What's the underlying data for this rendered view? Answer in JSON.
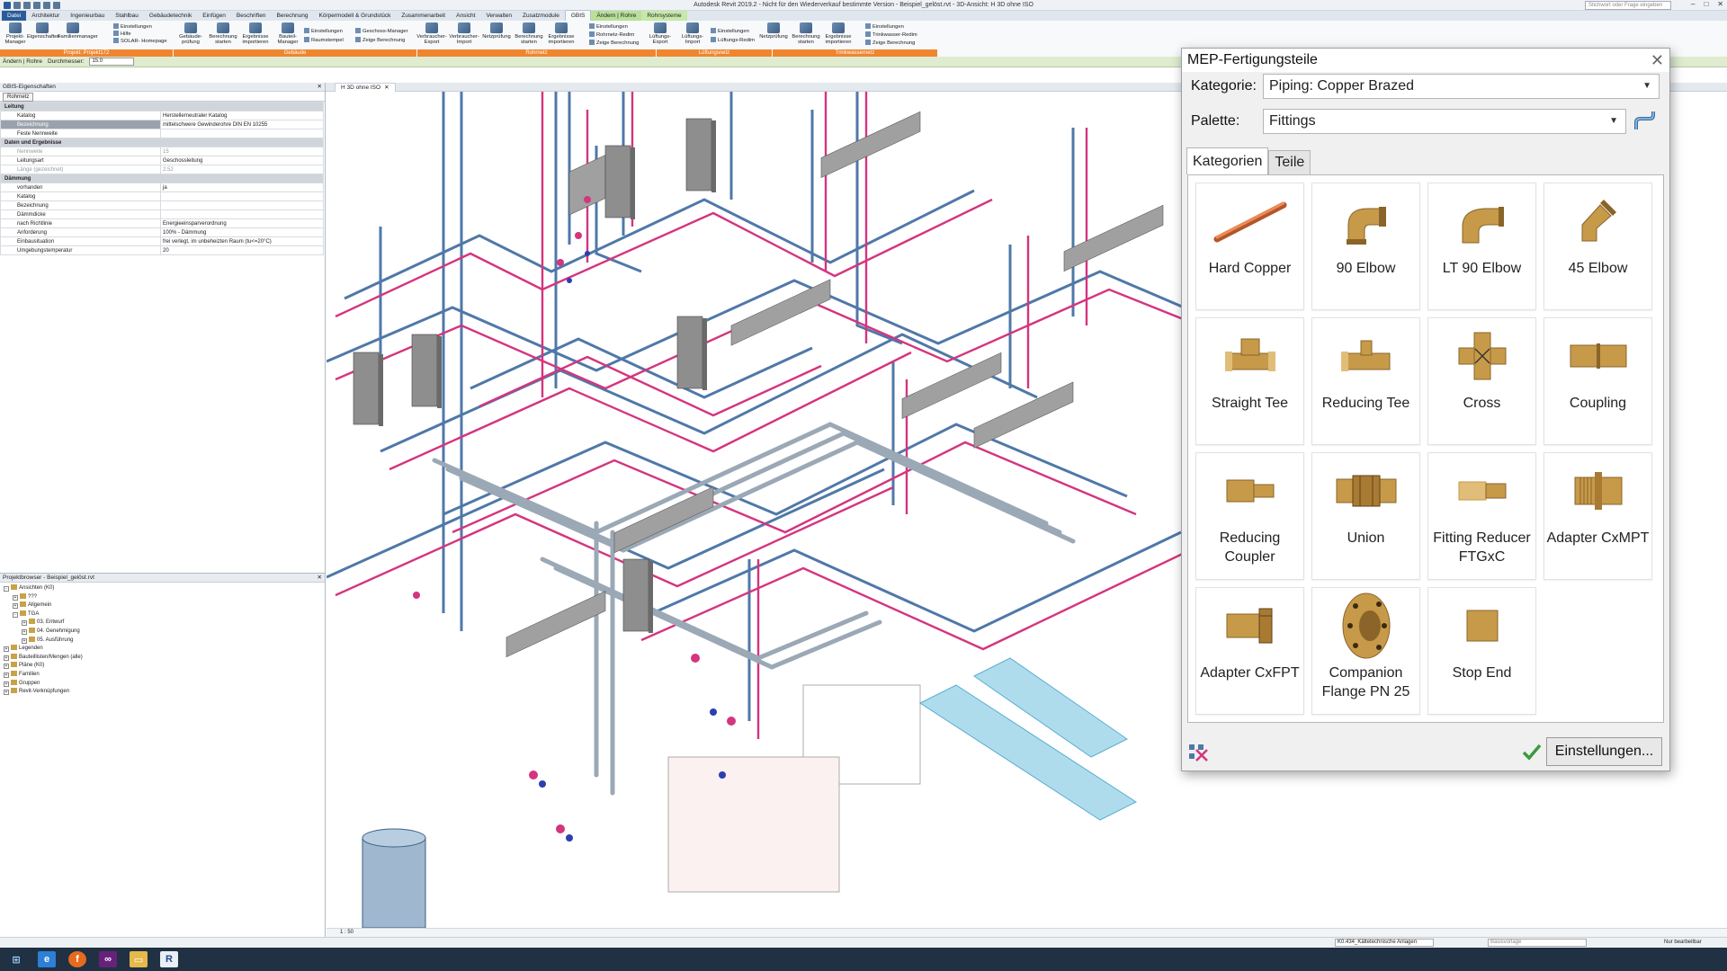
{
  "app": {
    "title": "Autodesk Revit 2019.2 - Nicht für den Wiederverkauf bestimmte Version - Beispiel_gelöst.rvt - 3D-Ansicht: H 3D ohne ISO",
    "search_placeholder": "Stichwort oder Frage eingeben"
  },
  "ribbon_tabs": [
    "Datei",
    "Architektur",
    "Ingenieurbau",
    "Stahlbau",
    "Gebäudetechnik",
    "Einfügen",
    "Beschriften",
    "Berechnung",
    "Körpermodell & Grundstück",
    "Zusammenarbeit",
    "Ansicht",
    "Verwalten",
    "Zusatzmodule",
    "GBIS",
    "Ändern | Rohre",
    "Rohrsysteme"
  ],
  "ribbon": {
    "buttons": [
      {
        "label": "Projekt-Manager"
      },
      {
        "label": "Eigenschaften"
      },
      {
        "label": "Familienmanager"
      },
      {
        "label": "Gebäude-prüfung"
      },
      {
        "label": "Berechnung starten"
      },
      {
        "label": "Ergebnisse importieren"
      },
      {
        "label": "Bauteil-Manager"
      },
      {
        "label": "Verbraucher-Export"
      },
      {
        "label": "Verbraucher-Import"
      },
      {
        "label": "Netzprüfung"
      },
      {
        "label": "Berechnung starten"
      },
      {
        "label": "Ergebnisse importieren"
      },
      {
        "label": "Lüftungs-Export"
      },
      {
        "label": "Lüftungs-Import"
      },
      {
        "label": "Netzprüfung"
      },
      {
        "label": "Berechnung starten"
      },
      {
        "label": "Ergebnisse importieren"
      }
    ],
    "small": [
      "Einstellungen",
      "Hilfe",
      "SOLAR- Homepage",
      "Einstellungen",
      "Raumstempel",
      "Geschoss-Manager",
      "Zeige Berechnung",
      "Einstellungen",
      "Rohrnetz-Redim",
      "Zeige Berechnung",
      "Einstellungen",
      "Lüftungs-Redim",
      "Einstellungen",
      "Trinkwasser-Redim",
      "Zeige Berechnung"
    ],
    "panels": [
      "Projekt: Projekt172",
      "Gebäude",
      "Rohrnetz",
      "Lüftungsnetz",
      "Trinkwassernetz"
    ]
  },
  "options_bar": {
    "mode": "Ändern | Rohre",
    "diameter_label": "Durchmesser:",
    "diameter_value": "15.0"
  },
  "properties": {
    "title": "GBIS-Eigenschaften",
    "type": "Rohrnetz",
    "rows": [
      {
        "k": "Leitung",
        "v": "",
        "group": true
      },
      {
        "k": "Katalog",
        "v": "Herstellerneutraler Katalog"
      },
      {
        "k": "Bezeichnung",
        "v": "mittelschwere Gewinderohre DIN EN 10255",
        "hl": true
      },
      {
        "k": "Feste Nennweite",
        "v": ""
      },
      {
        "k": "Daten und Ergebnisse",
        "v": "",
        "group": true
      },
      {
        "k": "Nennweite",
        "v": "15",
        "dis": true
      },
      {
        "k": "Leitungsart",
        "v": "Geschossleitung"
      },
      {
        "k": "Länge (gezeichnet)",
        "v": "2.52",
        "dis": true
      },
      {
        "k": "Dämmung",
        "v": "",
        "group": true
      },
      {
        "k": "vorhanden",
        "v": "ja"
      },
      {
        "k": "Katalog",
        "v": ""
      },
      {
        "k": "Bezeichnung",
        "v": ""
      },
      {
        "k": "Dämmdicke",
        "v": ""
      },
      {
        "k": "nach Richtlinie",
        "v": "Energieeinsparverordnung"
      },
      {
        "k": "Anforderung",
        "v": "100% - Dämmung"
      },
      {
        "k": "Einbausituation",
        "v": "frei verlegt, im unbeheizten Raum (tu<=20°C)"
      },
      {
        "k": "Umgebungstemperatur",
        "v": "20"
      }
    ]
  },
  "browser": {
    "title": "Projektbrowser - Beispiel_gelöst.rvt",
    "nodes": [
      {
        "label": "Ansichten (K0)",
        "lvl": 0,
        "exp": "-"
      },
      {
        "label": "???",
        "lvl": 1,
        "exp": "+"
      },
      {
        "label": "Allgemein",
        "lvl": 1,
        "exp": "+"
      },
      {
        "label": "TGA",
        "lvl": 1,
        "exp": "-"
      },
      {
        "label": "03. Entwurf",
        "lvl": 2,
        "exp": "+"
      },
      {
        "label": "04. Genehmigung",
        "lvl": 2,
        "exp": "+"
      },
      {
        "label": "05. Ausführung",
        "lvl": 2,
        "exp": "+"
      },
      {
        "label": "Legenden",
        "lvl": 0,
        "exp": "+"
      },
      {
        "label": "Bauteillisten/Mengen (alle)",
        "lvl": 0,
        "exp": "+"
      },
      {
        "label": "Pläne (K0)",
        "lvl": 0,
        "exp": "+"
      },
      {
        "label": "Familien",
        "lvl": 0,
        "exp": "+"
      },
      {
        "label": "Gruppen",
        "lvl": 0,
        "exp": "+"
      },
      {
        "label": "Revit-Verknüpfungen",
        "lvl": 0,
        "exp": "+"
      }
    ]
  },
  "view": {
    "tab": "H 3D ohne ISO",
    "scale": "1 : 50"
  },
  "status": {
    "workset": "K0.434_Kältetechnische Anlagen",
    "filter": "Basisvorlage",
    "editable_only": "Nur bearbeitbar"
  },
  "dialog": {
    "title": "MEP-Fertigungsteile",
    "category_label": "Kategorie:",
    "category_value": "Piping: Copper Brazed",
    "palette_label": "Palette:",
    "palette_value": "Fittings",
    "tabs": [
      "Kategorien",
      "Teile"
    ],
    "items": [
      {
        "name": "Hard Copper",
        "icon": "pipe-icon"
      },
      {
        "name": "90 Elbow",
        "icon": "elbow90-icon"
      },
      {
        "name": "LT 90 Elbow",
        "icon": "lt90-elbow-icon"
      },
      {
        "name": "45 Elbow",
        "icon": "elbow45-icon"
      },
      {
        "name": "Straight Tee",
        "icon": "tee-icon"
      },
      {
        "name": "Reducing Tee",
        "icon": "reducing-tee-icon"
      },
      {
        "name": "Cross",
        "icon": "cross-icon"
      },
      {
        "name": "Coupling",
        "icon": "coupling-icon"
      },
      {
        "name": "Reducing Coupler",
        "icon": "reducing-coupler-icon"
      },
      {
        "name": "Union",
        "icon": "union-icon"
      },
      {
        "name": "Fitting Reducer FTGxC",
        "icon": "fitting-reducer-icon"
      },
      {
        "name": "Adapter CxMPT",
        "icon": "adapter-cxmpt-icon"
      },
      {
        "name": "Adapter CxFPT",
        "icon": "adapter-cxfpt-icon"
      },
      {
        "name": "Companion Flange PN 25",
        "icon": "flange-icon"
      },
      {
        "name": "Stop End",
        "icon": "stop-end-icon"
      }
    ],
    "settings_label": "Einstellungen..."
  },
  "colors": {
    "copper": "#c79a4a",
    "pipe_blue": "#4f78a8",
    "pipe_pink": "#d4357e",
    "accent": "#f0852f"
  }
}
